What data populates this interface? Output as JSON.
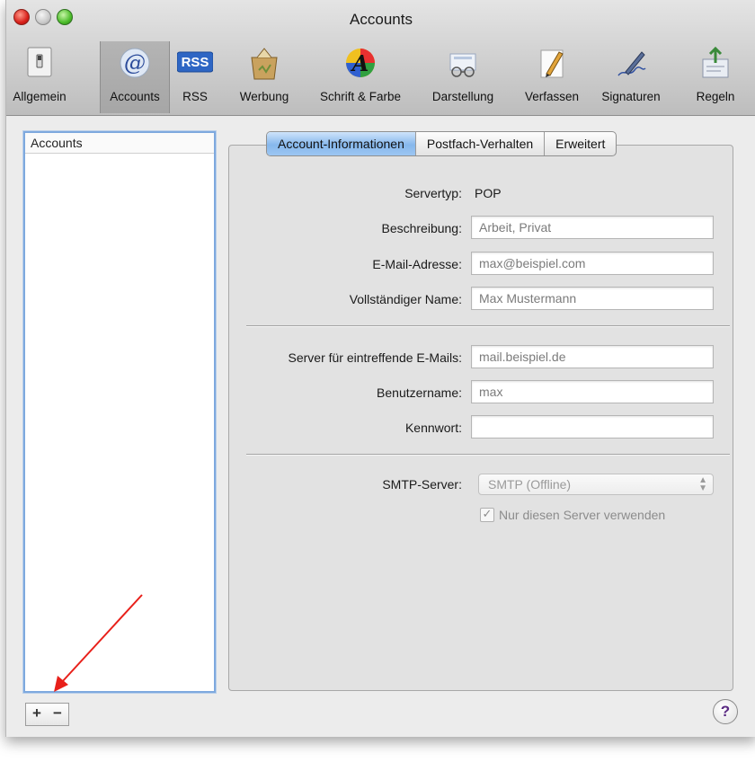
{
  "window": {
    "title": "Accounts"
  },
  "toolbar": {
    "items": [
      {
        "label": "Allgemein",
        "icon": "switch-icon"
      },
      {
        "label": "Accounts",
        "icon": "at-sign-icon"
      },
      {
        "label": "RSS",
        "icon": "rss-icon"
      },
      {
        "label": "Werbung",
        "icon": "junk-mail-icon"
      },
      {
        "label": "Schrift & Farbe",
        "icon": "font-color-icon"
      },
      {
        "label": "Darstellung",
        "icon": "glasses-icon"
      },
      {
        "label": "Verfassen",
        "icon": "pencil-icon"
      },
      {
        "label": "Signaturen",
        "icon": "signature-pen-icon"
      },
      {
        "label": "Regeln",
        "icon": "rules-icon"
      }
    ],
    "selected": "Accounts",
    "rss_badge": "RSS"
  },
  "sidebar": {
    "header": "Accounts",
    "add_label": "+",
    "remove_label": "−"
  },
  "tabs": [
    {
      "label": "Account-Informationen",
      "active": true
    },
    {
      "label": "Postfach-Verhalten",
      "active": false
    },
    {
      "label": "Erweitert",
      "active": false
    }
  ],
  "form": {
    "server_type_label": "Servertyp:",
    "server_type_value": "POP",
    "description_label": "Beschreibung:",
    "description_value": "Arbeit, Privat",
    "email_label": "E-Mail-Adresse:",
    "email_value": "max@beispiel.com",
    "fullname_label": "Vollständiger Name:",
    "fullname_value": "Max Mustermann",
    "incoming_label": "Server für eintreffende E-Mails:",
    "incoming_value": "mail.beispiel.de",
    "username_label": "Benutzername:",
    "username_value": "max",
    "password_label": "Kennwort:",
    "password_value": "",
    "smtp_label": "SMTP-Server:",
    "smtp_value": "SMTP (Offline)",
    "only_this_server_label": "Nur diesen Server verwenden",
    "only_this_server_checked": true
  },
  "help": {
    "label": "?"
  },
  "annotation": {
    "arrow_color": "#e8201a"
  }
}
